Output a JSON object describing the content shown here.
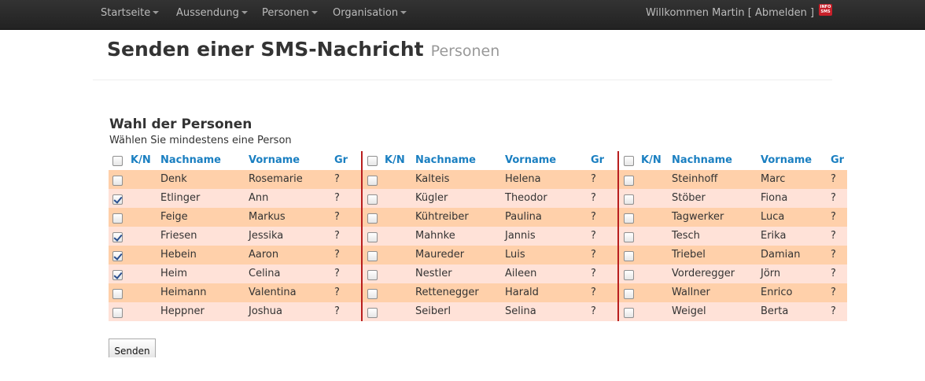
{
  "nav": {
    "items": [
      "Startseite",
      "Aussendung",
      "Personen",
      "Organisation"
    ],
    "welcome_prefix": "Willkommen Martin [",
    "logout": "Abmelden",
    "welcome_suffix": "]",
    "logo_text": "INFO SMS"
  },
  "header": {
    "title": "Senden einer SMS-Nachricht",
    "subtitle": "Personen"
  },
  "section": {
    "title": "Wahl der Personen",
    "hint": "Wählen Sie mindestens eine Person"
  },
  "columns": {
    "kn": "K/N",
    "lastname": "Nachname",
    "firstname": "Vorname",
    "group": "Gr"
  },
  "tables": [
    {
      "rows": [
        {
          "lastname": "Denk",
          "firstname": "Rosemarie",
          "group": "?",
          "checked": false
        },
        {
          "lastname": "Etlinger",
          "firstname": "Ann",
          "group": "?",
          "checked": true
        },
        {
          "lastname": "Feige",
          "firstname": "Markus",
          "group": "?",
          "checked": false
        },
        {
          "lastname": "Friesen",
          "firstname": "Jessika",
          "group": "?",
          "checked": true
        },
        {
          "lastname": "Hebein",
          "firstname": "Aaron",
          "group": "?",
          "checked": true
        },
        {
          "lastname": "Heim",
          "firstname": "Celina",
          "group": "?",
          "checked": true
        },
        {
          "lastname": "Heimann",
          "firstname": "Valentina",
          "group": "?",
          "checked": false
        },
        {
          "lastname": "Heppner",
          "firstname": "Joshua",
          "group": "?",
          "checked": false
        }
      ]
    },
    {
      "rows": [
        {
          "lastname": "Kalteis",
          "firstname": "Helena",
          "group": "?",
          "checked": false
        },
        {
          "lastname": "Kügler",
          "firstname": "Theodor",
          "group": "?",
          "checked": false
        },
        {
          "lastname": "Kühtreiber",
          "firstname": "Paulina",
          "group": "?",
          "checked": false
        },
        {
          "lastname": "Mahnke",
          "firstname": "Jannis",
          "group": "?",
          "checked": false
        },
        {
          "lastname": "Maureder",
          "firstname": "Luis",
          "group": "?",
          "checked": false
        },
        {
          "lastname": "Nestler",
          "firstname": "Aileen",
          "group": "?",
          "checked": false
        },
        {
          "lastname": "Rettenegger",
          "firstname": "Harald",
          "group": "?",
          "checked": false
        },
        {
          "lastname": "Seiberl",
          "firstname": "Selina",
          "group": "?",
          "checked": false
        }
      ]
    },
    {
      "rows": [
        {
          "lastname": "Steinhoff",
          "firstname": "Marc",
          "group": "?",
          "checked": false
        },
        {
          "lastname": "Stöber",
          "firstname": "Fiona",
          "group": "?",
          "checked": false
        },
        {
          "lastname": "Tagwerker",
          "firstname": "Luca",
          "group": "?",
          "checked": false
        },
        {
          "lastname": "Tesch",
          "firstname": "Erika",
          "group": "?",
          "checked": false
        },
        {
          "lastname": "Triebel",
          "firstname": "Damian",
          "group": "?",
          "checked": false
        },
        {
          "lastname": "Vorderegger",
          "firstname": "Jörn",
          "group": "?",
          "checked": false
        },
        {
          "lastname": "Wallner",
          "firstname": "Enrico",
          "group": "?",
          "checked": false
        },
        {
          "lastname": "Weigel",
          "firstname": "Berta",
          "group": "?",
          "checked": false
        }
      ]
    }
  ],
  "send_label": "Senden",
  "colors": {
    "navbar": "#222222",
    "header_link": "#1a7fc1",
    "row_odd": "#ffd0aa",
    "row_even": "#ffe2d8",
    "separator": "#b91e1e"
  }
}
